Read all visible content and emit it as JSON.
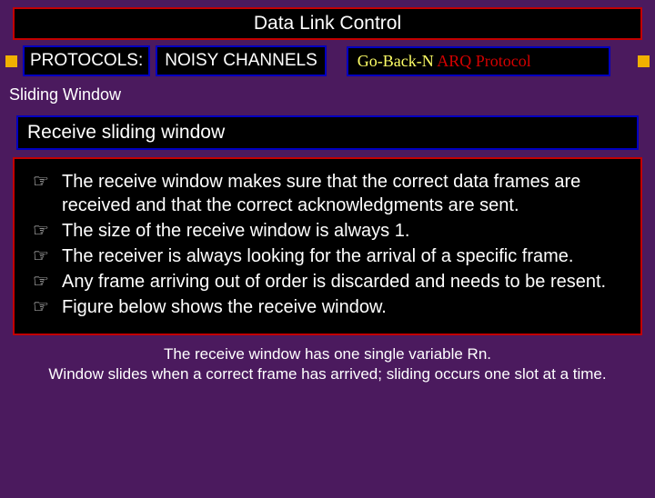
{
  "title": "Data Link Control",
  "tags": {
    "protocols": "PROTOCOLS:",
    "noisy": "NOISY CHANNELS",
    "goback_part1": "Go-Back-N ",
    "goback_part2": "ARQ Protocol"
  },
  "sub_bar": "Sliding Window",
  "section_title": "Receive sliding window",
  "bullets": [
    "The receive window makes sure that the correct data frames are received and that the correct acknowledgments are sent.",
    "The size of the receive window is always 1.",
    "The receiver is always looking for the arrival of a specific frame.",
    "Any frame arriving out of order is discarded and needs to be resent.",
    "Figure below shows the receive window."
  ],
  "footer_line1": "The receive window has one single variable Rn.",
  "footer_line2": "Window slides when a correct frame has arrived; sliding occurs one slot at a time."
}
